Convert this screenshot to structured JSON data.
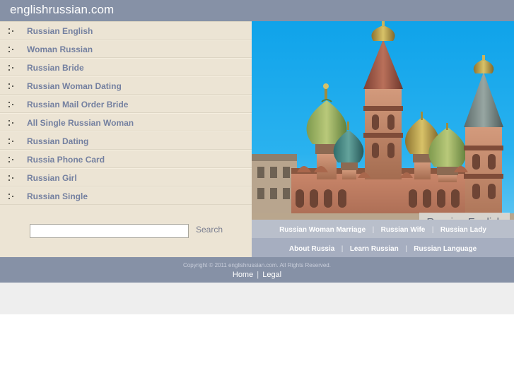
{
  "header": {
    "site_title": "englishrussian.com",
    "bg_color": "#8691a6"
  },
  "sidebar": {
    "bg_color": "#ece4d4",
    "bullet_icon": "three-dots-icon",
    "items": [
      {
        "label": "Russian English"
      },
      {
        "label": "Woman Russian"
      },
      {
        "label": "Russian Bride"
      },
      {
        "label": "Russian Woman Dating"
      },
      {
        "label": "Russian Mail Order Bride"
      },
      {
        "label": "All Single Russian Woman"
      },
      {
        "label": "Russian Dating"
      },
      {
        "label": "Russia Phone Card"
      },
      {
        "label": "Russian Girl"
      },
      {
        "label": "Russian Single"
      }
    ]
  },
  "search": {
    "value": "",
    "placeholder": "",
    "button_label": "Search"
  },
  "photo": {
    "caption": "Russian English",
    "alt_name": "saint-basils-cathedral-photo",
    "sky_color": "#18a6e8"
  },
  "nav_row_1": {
    "bg_color": "#b9bfcb",
    "separator": "|",
    "links": [
      {
        "label": "Russian Woman Marriage"
      },
      {
        "label": "Russian Wife"
      },
      {
        "label": "Russian Lady"
      }
    ]
  },
  "nav_row_2": {
    "bg_color": "#a6aec0",
    "separator": "|",
    "links": [
      {
        "label": "About Russia"
      },
      {
        "label": "Learn Russian"
      },
      {
        "label": "Russian Language"
      }
    ]
  },
  "footer": {
    "bg_color": "#8691a6",
    "copyright": "Copyright © 2011 englishrussian.com. All Rights Reserved.",
    "separator": "|",
    "links": [
      {
        "label": "Home"
      },
      {
        "label": "Legal"
      }
    ]
  }
}
